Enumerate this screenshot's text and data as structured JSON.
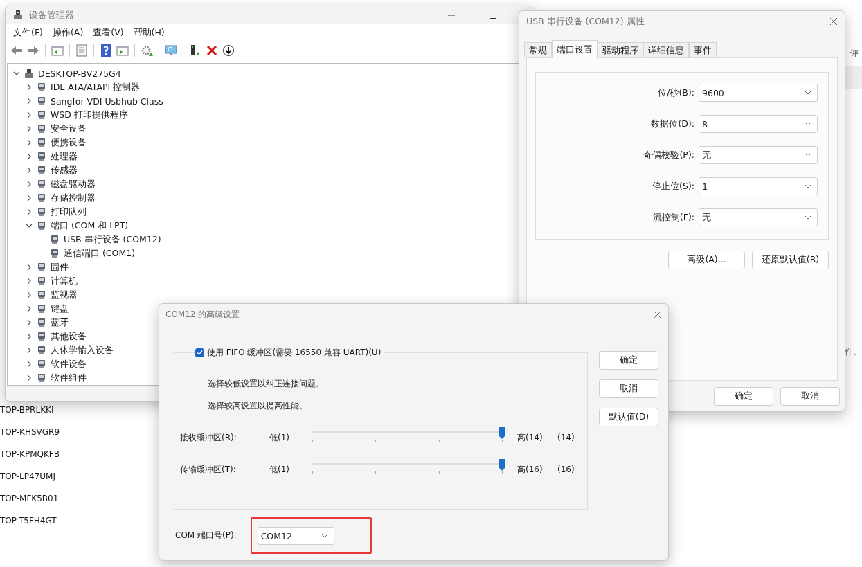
{
  "background": {
    "hosts": [
      "TOP-BPRLKKI",
      "TOP-KHSVGR9",
      "TOP-KPMQKFB",
      "TOP-LP47UMJ",
      "TOP-MFK5B01",
      "TOP-T5FH4GT"
    ],
    "column_heading": "评",
    "note_fragment": "件。"
  },
  "device_manager": {
    "title": "设备管理器",
    "menu": [
      "文件(F)",
      "操作(A)",
      "查看(V)",
      "帮助(H)"
    ],
    "tree": {
      "label": "DESKTOP-BV275G4",
      "expanded": true,
      "children": [
        {
          "label": "IDE ATA/ATAPI 控制器",
          "expanded": false
        },
        {
          "label": "Sangfor VDI Usbhub Class",
          "expanded": false
        },
        {
          "label": "WSD 打印提供程序",
          "expanded": false
        },
        {
          "label": "安全设备",
          "expanded": false
        },
        {
          "label": "便携设备",
          "expanded": false
        },
        {
          "label": "处理器",
          "expanded": false
        },
        {
          "label": "传感器",
          "expanded": false
        },
        {
          "label": "磁盘驱动器",
          "expanded": false
        },
        {
          "label": "存储控制器",
          "expanded": false
        },
        {
          "label": "打印队列",
          "expanded": false
        },
        {
          "label": "端口 (COM 和 LPT)",
          "expanded": true,
          "children": [
            {
              "label": "USB 串行设备 (COM12)"
            },
            {
              "label": "通信端口 (COM1)"
            }
          ]
        },
        {
          "label": "固件",
          "expanded": false
        },
        {
          "label": "计算机",
          "expanded": false
        },
        {
          "label": "监视器",
          "expanded": false
        },
        {
          "label": "键盘",
          "expanded": false
        },
        {
          "label": "蓝牙",
          "expanded": false
        },
        {
          "label": "其他设备",
          "expanded": false
        },
        {
          "label": "人体学输入设备",
          "expanded": false
        },
        {
          "label": "软件设备",
          "expanded": false
        },
        {
          "label": "软件组件",
          "expanded": false
        }
      ]
    }
  },
  "properties": {
    "title": "USB 串行设备 (COM12) 属性",
    "tabs": [
      {
        "label": "常规",
        "selected": false
      },
      {
        "label": "端口设置",
        "selected": true
      },
      {
        "label": "驱动程序",
        "selected": false
      },
      {
        "label": "详细信息",
        "selected": false
      },
      {
        "label": "事件",
        "selected": false
      }
    ],
    "fields": [
      {
        "label": "位/秒(B):",
        "value": "9600"
      },
      {
        "label": "数据位(D):",
        "value": "8"
      },
      {
        "label": "奇偶校验(P):",
        "value": "无"
      },
      {
        "label": "停止位(S):",
        "value": "1"
      },
      {
        "label": "流控制(F):",
        "value": "无"
      }
    ],
    "buttons": [
      "高级(A)...",
      "还原默认值(R)"
    ],
    "footer_buttons": [
      "确定",
      "取消"
    ]
  },
  "advanced": {
    "title": "COM12 的高级设置",
    "fifo": {
      "label": "使用 FIFO 缓冲区(需要 16550 兼容 UART)(U)",
      "checked": true
    },
    "hints": [
      "选择较低设置以纠正连接问题。",
      "选择较高设置以提高性能。"
    ],
    "sliders": [
      {
        "label": "接收缓冲区(R):",
        "low": "低(1)",
        "high": "高(14)",
        "reading": "(14)",
        "level": 1
      },
      {
        "label": "传输缓冲区(T):",
        "low": "低(1)",
        "high": "高(16)",
        "reading": "(16)",
        "level": 1
      }
    ],
    "port": {
      "label": "COM 端口号(P):",
      "value": "COM12"
    },
    "buttons": [
      "确定",
      "取消",
      "默认值(D)"
    ]
  }
}
